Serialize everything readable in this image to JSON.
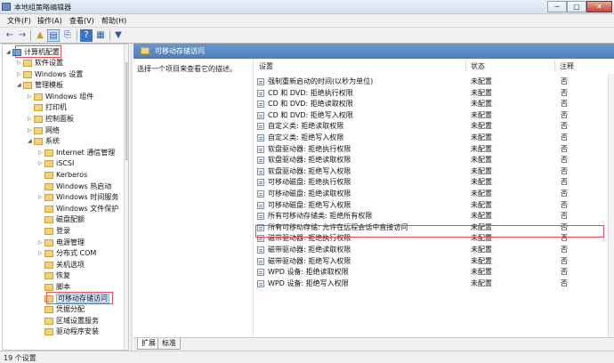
{
  "window": {
    "title": "本地组策略编辑器"
  },
  "window_controls": {
    "minimize": "─",
    "maximize": "□",
    "close": "✕"
  },
  "menu": {
    "items": [
      "文件(F)",
      "操作(A)",
      "查看(V)",
      "帮助(H)"
    ]
  },
  "toolbar": {
    "back": "←",
    "forward": "→",
    "up": "▲",
    "show_hide": "▤",
    "export": "⎘",
    "help": "?",
    "properties": "▦",
    "filter": "▼"
  },
  "tree": {
    "root": "计算机配置",
    "items": [
      {
        "label": "软件设置",
        "expander": "▷"
      },
      {
        "label": "Windows 设置",
        "expander": "▷"
      },
      {
        "label": "管理模板",
        "expander": "◢"
      },
      {
        "label": "Windows 组件",
        "expander": "▷"
      },
      {
        "label": "打印机",
        "expander": ""
      },
      {
        "label": "控制面板",
        "expander": "▷"
      },
      {
        "label": "网络",
        "expander": "▷"
      },
      {
        "label": "系统",
        "expander": "◢"
      },
      {
        "label": "Internet 通信管理",
        "expander": "▷"
      },
      {
        "label": "iSCSI",
        "expander": "▷"
      },
      {
        "label": "Kerberos",
        "expander": ""
      },
      {
        "label": "Windows 热启动",
        "expander": ""
      },
      {
        "label": "Windows 时间服务",
        "expander": "▷"
      },
      {
        "label": "Windows 文件保护",
        "expander": ""
      },
      {
        "label": "磁盘配额",
        "expander": ""
      },
      {
        "label": "登录",
        "expander": ""
      },
      {
        "label": "电源管理",
        "expander": "▷"
      },
      {
        "label": "分布式 COM",
        "expander": "▷"
      },
      {
        "label": "关机选项",
        "expander": ""
      },
      {
        "label": "恢复",
        "expander": ""
      },
      {
        "label": "脚本",
        "expander": ""
      },
      {
        "label": "可移动存储访问",
        "expander": "",
        "selected": true
      },
      {
        "label": "凭据分配",
        "expander": ""
      },
      {
        "label": "区域设置服务",
        "expander": ""
      },
      {
        "label": "驱动程序安装",
        "expander": ""
      }
    ]
  },
  "content": {
    "header": "可移动存储访问",
    "description": "选择一个项目来查看它的描述。",
    "columns": {
      "setting": "设置",
      "state": "状态",
      "note": "注释"
    },
    "rows": [
      {
        "setting": "强制重新启动的时间(以秒为单位)",
        "state": "未配置",
        "note": "否"
      },
      {
        "setting": "CD 和 DVD: 拒绝执行权限",
        "state": "未配置",
        "note": "否"
      },
      {
        "setting": "CD 和 DVD: 拒绝读取权限",
        "state": "未配置",
        "note": "否"
      },
      {
        "setting": "CD 和 DVD: 拒绝写入权限",
        "state": "未配置",
        "note": "否"
      },
      {
        "setting": "自定义类: 拒绝读取权限",
        "state": "未配置",
        "note": "否"
      },
      {
        "setting": "自定义类: 拒绝写入权限",
        "state": "未配置",
        "note": "否"
      },
      {
        "setting": "软盘驱动器: 拒绝执行权限",
        "state": "未配置",
        "note": "否"
      },
      {
        "setting": "软盘驱动器: 拒绝读取权限",
        "state": "未配置",
        "note": "否"
      },
      {
        "setting": "软盘驱动器: 拒绝写入权限",
        "state": "未配置",
        "note": "否"
      },
      {
        "setting": "可移动磁盘: 拒绝执行权限",
        "state": "未配置",
        "note": "否",
        "highlighted": true
      },
      {
        "setting": "可移动磁盘: 拒绝读取权限",
        "state": "未配置",
        "note": "否"
      },
      {
        "setting": "可移动磁盘: 拒绝写入权限",
        "state": "未配置",
        "note": "否"
      },
      {
        "setting": "所有可移动存储类: 拒绝所有权限",
        "state": "未配置",
        "note": "否"
      },
      {
        "setting": "所有可移动存储: 允许在远程会话中直接访问",
        "state": "未配置",
        "note": "否"
      },
      {
        "setting": "磁带驱动器: 拒绝执行权限",
        "state": "未配置",
        "note": "否"
      },
      {
        "setting": "磁带驱动器: 拒绝读取权限",
        "state": "未配置",
        "note": "否"
      },
      {
        "setting": "磁带驱动器: 拒绝写入权限",
        "state": "未配置",
        "note": "否"
      },
      {
        "setting": "WPD 设备: 拒绝读取权限",
        "state": "未配置",
        "note": "否"
      },
      {
        "setting": "WPD 设备: 拒绝写入权限",
        "state": "未配置",
        "note": "否"
      }
    ]
  },
  "tabs": [
    {
      "label": "扩展",
      "active": true
    },
    {
      "label": "标准",
      "active": false
    }
  ],
  "status": {
    "text": "19 个设置"
  }
}
